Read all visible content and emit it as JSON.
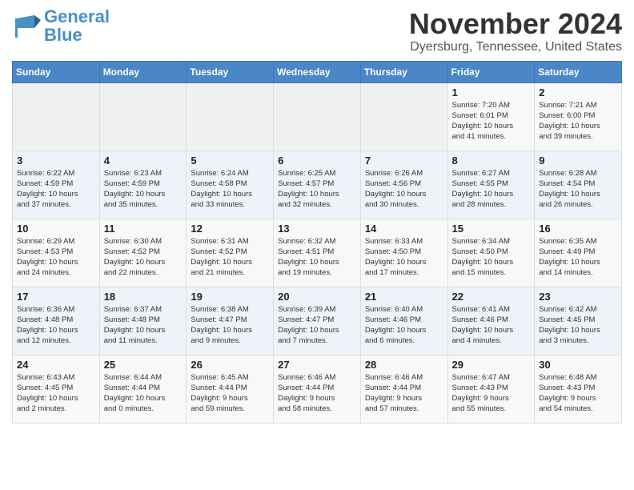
{
  "logo": {
    "text_general": "General",
    "text_blue": "Blue"
  },
  "title": "November 2024",
  "location": "Dyersburg, Tennessee, United States",
  "days_of_week": [
    "Sunday",
    "Monday",
    "Tuesday",
    "Wednesday",
    "Thursday",
    "Friday",
    "Saturday"
  ],
  "weeks": [
    [
      {
        "day": "",
        "info": ""
      },
      {
        "day": "",
        "info": ""
      },
      {
        "day": "",
        "info": ""
      },
      {
        "day": "",
        "info": ""
      },
      {
        "day": "",
        "info": ""
      },
      {
        "day": "1",
        "info": "Sunrise: 7:20 AM\nSunset: 6:01 PM\nDaylight: 10 hours\nand 41 minutes."
      },
      {
        "day": "2",
        "info": "Sunrise: 7:21 AM\nSunset: 6:00 PM\nDaylight: 10 hours\nand 39 minutes."
      }
    ],
    [
      {
        "day": "3",
        "info": "Sunrise: 6:22 AM\nSunset: 4:59 PM\nDaylight: 10 hours\nand 37 minutes."
      },
      {
        "day": "4",
        "info": "Sunrise: 6:23 AM\nSunset: 4:59 PM\nDaylight: 10 hours\nand 35 minutes."
      },
      {
        "day": "5",
        "info": "Sunrise: 6:24 AM\nSunset: 4:58 PM\nDaylight: 10 hours\nand 33 minutes."
      },
      {
        "day": "6",
        "info": "Sunrise: 6:25 AM\nSunset: 4:57 PM\nDaylight: 10 hours\nand 32 minutes."
      },
      {
        "day": "7",
        "info": "Sunrise: 6:26 AM\nSunset: 4:56 PM\nDaylight: 10 hours\nand 30 minutes."
      },
      {
        "day": "8",
        "info": "Sunrise: 6:27 AM\nSunset: 4:55 PM\nDaylight: 10 hours\nand 28 minutes."
      },
      {
        "day": "9",
        "info": "Sunrise: 6:28 AM\nSunset: 4:54 PM\nDaylight: 10 hours\nand 26 minutes."
      }
    ],
    [
      {
        "day": "10",
        "info": "Sunrise: 6:29 AM\nSunset: 4:53 PM\nDaylight: 10 hours\nand 24 minutes."
      },
      {
        "day": "11",
        "info": "Sunrise: 6:30 AM\nSunset: 4:52 PM\nDaylight: 10 hours\nand 22 minutes."
      },
      {
        "day": "12",
        "info": "Sunrise: 6:31 AM\nSunset: 4:52 PM\nDaylight: 10 hours\nand 21 minutes."
      },
      {
        "day": "13",
        "info": "Sunrise: 6:32 AM\nSunset: 4:51 PM\nDaylight: 10 hours\nand 19 minutes."
      },
      {
        "day": "14",
        "info": "Sunrise: 6:33 AM\nSunset: 4:50 PM\nDaylight: 10 hours\nand 17 minutes."
      },
      {
        "day": "15",
        "info": "Sunrise: 6:34 AM\nSunset: 4:50 PM\nDaylight: 10 hours\nand 15 minutes."
      },
      {
        "day": "16",
        "info": "Sunrise: 6:35 AM\nSunset: 4:49 PM\nDaylight: 10 hours\nand 14 minutes."
      }
    ],
    [
      {
        "day": "17",
        "info": "Sunrise: 6:36 AM\nSunset: 4:48 PM\nDaylight: 10 hours\nand 12 minutes."
      },
      {
        "day": "18",
        "info": "Sunrise: 6:37 AM\nSunset: 4:48 PM\nDaylight: 10 hours\nand 11 minutes."
      },
      {
        "day": "19",
        "info": "Sunrise: 6:38 AM\nSunset: 4:47 PM\nDaylight: 10 hours\nand 9 minutes."
      },
      {
        "day": "20",
        "info": "Sunrise: 6:39 AM\nSunset: 4:47 PM\nDaylight: 10 hours\nand 7 minutes."
      },
      {
        "day": "21",
        "info": "Sunrise: 6:40 AM\nSunset: 4:46 PM\nDaylight: 10 hours\nand 6 minutes."
      },
      {
        "day": "22",
        "info": "Sunrise: 6:41 AM\nSunset: 4:46 PM\nDaylight: 10 hours\nand 4 minutes."
      },
      {
        "day": "23",
        "info": "Sunrise: 6:42 AM\nSunset: 4:45 PM\nDaylight: 10 hours\nand 3 minutes."
      }
    ],
    [
      {
        "day": "24",
        "info": "Sunrise: 6:43 AM\nSunset: 4:45 PM\nDaylight: 10 hours\nand 2 minutes."
      },
      {
        "day": "25",
        "info": "Sunrise: 6:44 AM\nSunset: 4:44 PM\nDaylight: 10 hours\nand 0 minutes."
      },
      {
        "day": "26",
        "info": "Sunrise: 6:45 AM\nSunset: 4:44 PM\nDaylight: 9 hours\nand 59 minutes."
      },
      {
        "day": "27",
        "info": "Sunrise: 6:46 AM\nSunset: 4:44 PM\nDaylight: 9 hours\nand 58 minutes."
      },
      {
        "day": "28",
        "info": "Sunrise: 6:46 AM\nSunset: 4:44 PM\nDaylight: 9 hours\nand 57 minutes."
      },
      {
        "day": "29",
        "info": "Sunrise: 6:47 AM\nSunset: 4:43 PM\nDaylight: 9 hours\nand 55 minutes."
      },
      {
        "day": "30",
        "info": "Sunrise: 6:48 AM\nSunset: 4:43 PM\nDaylight: 9 hours\nand 54 minutes."
      }
    ]
  ]
}
